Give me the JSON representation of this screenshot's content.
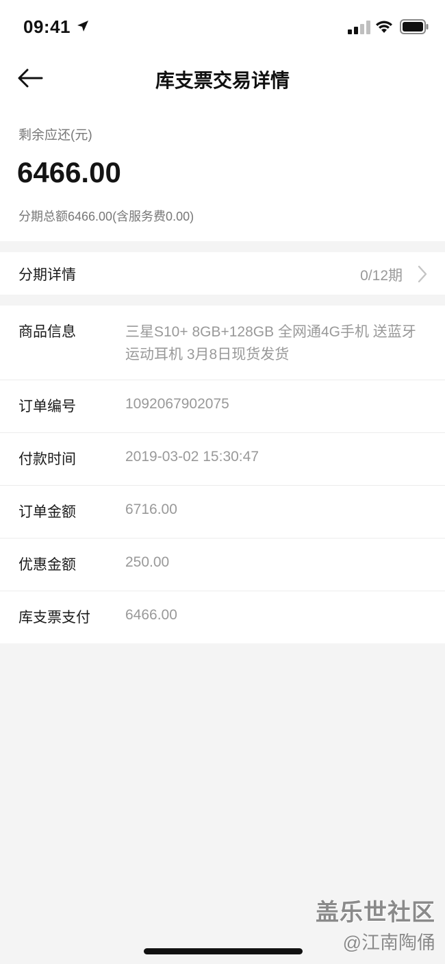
{
  "status_bar": {
    "time": "09:41",
    "icons": [
      "location-arrow-icon",
      "signal-icon",
      "wifi-icon",
      "battery-icon"
    ]
  },
  "nav": {
    "title": "库支票交易详情",
    "back_icon": "back-arrow-icon"
  },
  "summary": {
    "remaining_label": "剩余应还(元)",
    "remaining_amount": "6466.00",
    "total_text": "分期总额6466.00(含服务费0.00)"
  },
  "installment": {
    "label": "分期详情",
    "value": "0/12期",
    "icon": "chevron-right-icon"
  },
  "details": [
    {
      "label": "商品信息",
      "value": "三星S10+ 8GB+128GB 全网通4G手机 送蓝牙运动耳机 3月8日现货发货"
    },
    {
      "label": "订单编号",
      "value": "1092067902075"
    },
    {
      "label": "付款时间",
      "value": "2019-03-02 15:30:47"
    },
    {
      "label": "订单金额",
      "value": "6716.00"
    },
    {
      "label": "优惠金额",
      "value": "250.00"
    },
    {
      "label": "库支票支付",
      "value": "6466.00"
    }
  ],
  "watermark": {
    "logo": "盖乐世社区",
    "author": "@江南陶俑"
  },
  "colors": {
    "background": "#f4f4f4",
    "card": "#ffffff",
    "text_primary": "#1a1a1a",
    "text_secondary": "#999999"
  }
}
